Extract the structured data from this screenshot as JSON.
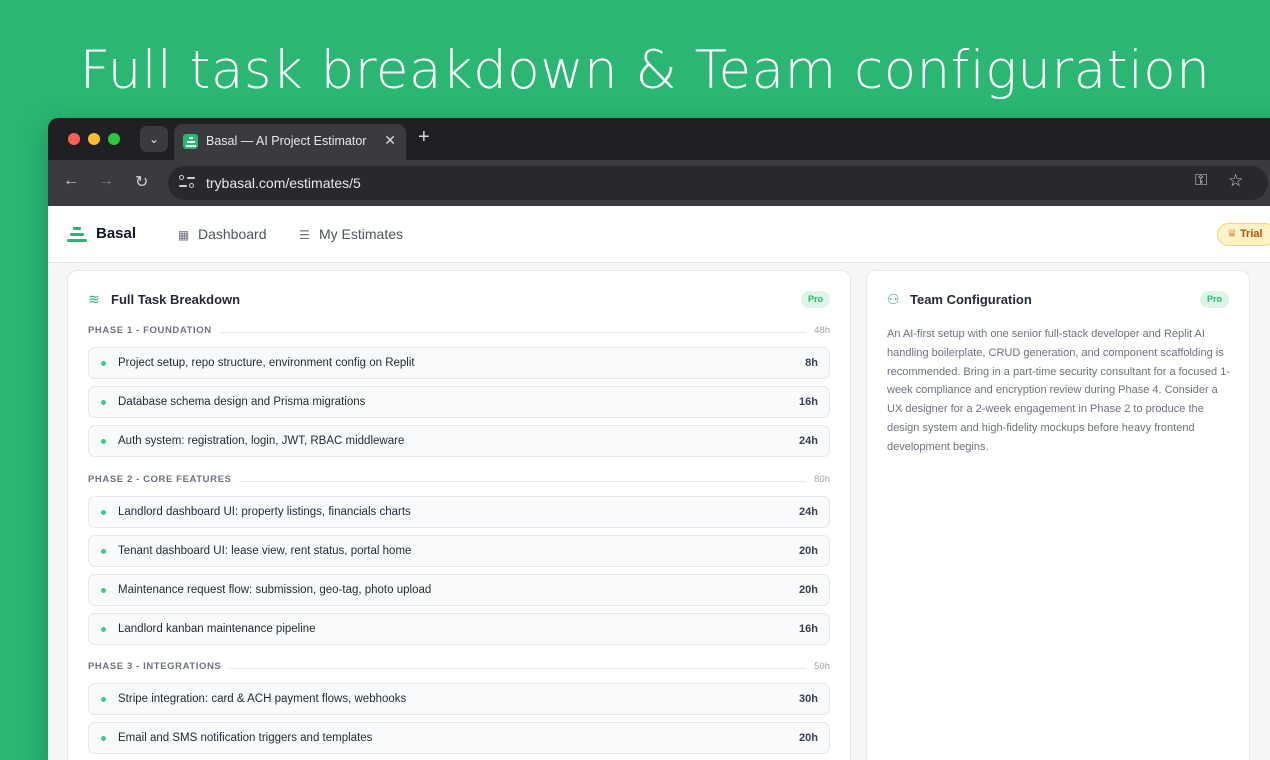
{
  "headline": "Full task breakdown & Team configuration",
  "browser": {
    "tab_title": "Basal — AI Project Estimator",
    "url": "trybasal.com/estimates/5"
  },
  "app": {
    "brand": "Basal",
    "nav": {
      "dashboard": "Dashboard",
      "my_estimates": "My Estimates"
    },
    "trial_label": "Trial"
  },
  "tasks_card": {
    "title": "Full Task Breakdown",
    "badge": "Pro",
    "phases": [
      {
        "label": "PHASE 1 - FOUNDATION",
        "hours": "48h",
        "tasks": [
          {
            "name": "Project setup, repo structure, environment config on Replit",
            "hours": "8h"
          },
          {
            "name": "Database schema design and Prisma migrations",
            "hours": "16h"
          },
          {
            "name": "Auth system: registration, login, JWT, RBAC middleware",
            "hours": "24h"
          }
        ]
      },
      {
        "label": "PHASE 2 - CORE FEATURES",
        "hours": "80h",
        "tasks": [
          {
            "name": "Landlord dashboard UI: property listings, financials charts",
            "hours": "24h"
          },
          {
            "name": "Tenant dashboard UI: lease view, rent status, portal home",
            "hours": "20h"
          },
          {
            "name": "Maintenance request flow: submission, geo-tag, photo upload",
            "hours": "20h"
          },
          {
            "name": "Landlord kanban maintenance pipeline",
            "hours": "16h"
          }
        ]
      },
      {
        "label": "PHASE 3 - INTEGRATIONS",
        "hours": "50h",
        "tasks": [
          {
            "name": "Stripe integration: card & ACH payment flows, webhooks",
            "hours": "30h"
          },
          {
            "name": "Email and SMS notification triggers and templates",
            "hours": "20h"
          }
        ]
      }
    ]
  },
  "team_card": {
    "title": "Team Configuration",
    "badge": "Pro",
    "description": "An AI-first setup with one senior full-stack developer and Replit AI handling boilerplate, CRUD generation, and component scaffolding is recommended. Bring in a part-time security consultant for a focused 1-week compliance and encryption review during Phase 4. Consider a UX designer for a 2-week engagement in Phase 2 to produce the design system and high-fidelity mockups before heavy frontend development begins."
  },
  "colors": {
    "accent": "#2bb673",
    "background": "#2bb673"
  }
}
